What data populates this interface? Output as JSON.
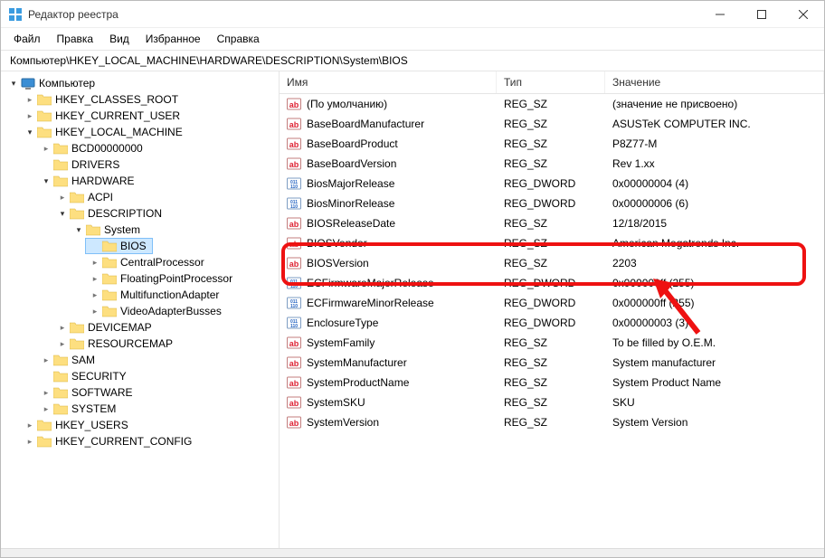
{
  "window": {
    "title": "Редактор реестра"
  },
  "menu": [
    "Файл",
    "Правка",
    "Вид",
    "Избранное",
    "Справка"
  ],
  "address": "Компьютер\\HKEY_LOCAL_MACHINE\\HARDWARE\\DESCRIPTION\\System\\BIOS",
  "tree": {
    "root": "Компьютер",
    "items": [
      {
        "label": "HKEY_CLASSES_ROOT",
        "caret": "closed",
        "depth": 1
      },
      {
        "label": "HKEY_CURRENT_USER",
        "caret": "closed",
        "depth": 1
      },
      {
        "label": "HKEY_LOCAL_MACHINE",
        "caret": "open",
        "depth": 1
      },
      {
        "label": "BCD00000000",
        "caret": "closed",
        "depth": 2
      },
      {
        "label": "DRIVERS",
        "caret": "none",
        "depth": 2
      },
      {
        "label": "HARDWARE",
        "caret": "open",
        "depth": 2
      },
      {
        "label": "ACPI",
        "caret": "closed",
        "depth": 3
      },
      {
        "label": "DESCRIPTION",
        "caret": "open",
        "depth": 3
      },
      {
        "label": "System",
        "caret": "open",
        "depth": 4
      },
      {
        "label": "BIOS",
        "caret": "none",
        "depth": 5,
        "selected": true
      },
      {
        "label": "CentralProcessor",
        "caret": "closed",
        "depth": 5
      },
      {
        "label": "FloatingPointProcessor",
        "caret": "closed",
        "depth": 5
      },
      {
        "label": "MultifunctionAdapter",
        "caret": "closed",
        "depth": 5
      },
      {
        "label": "VideoAdapterBusses",
        "caret": "closed",
        "depth": 5
      },
      {
        "label": "DEVICEMAP",
        "caret": "closed",
        "depth": 3
      },
      {
        "label": "RESOURCEMAP",
        "caret": "closed",
        "depth": 3
      },
      {
        "label": "SAM",
        "caret": "closed",
        "depth": 2
      },
      {
        "label": "SECURITY",
        "caret": "none",
        "depth": 2
      },
      {
        "label": "SOFTWARE",
        "caret": "closed",
        "depth": 2
      },
      {
        "label": "SYSTEM",
        "caret": "closed",
        "depth": 2
      },
      {
        "label": "HKEY_USERS",
        "caret": "closed",
        "depth": 1
      },
      {
        "label": "HKEY_CURRENT_CONFIG",
        "caret": "closed",
        "depth": 1
      }
    ]
  },
  "list": {
    "headers": {
      "name": "Имя",
      "type": "Тип",
      "value": "Значение"
    },
    "rows": [
      {
        "icon": "sz",
        "name": "(По умолчанию)",
        "type": "REG_SZ",
        "value": "(значение не присвоено)"
      },
      {
        "icon": "sz",
        "name": "BaseBoardManufacturer",
        "type": "REG_SZ",
        "value": "ASUSTeK COMPUTER INC."
      },
      {
        "icon": "sz",
        "name": "BaseBoardProduct",
        "type": "REG_SZ",
        "value": "P8Z77-M"
      },
      {
        "icon": "sz",
        "name": "BaseBoardVersion",
        "type": "REG_SZ",
        "value": "Rev 1.xx"
      },
      {
        "icon": "dw",
        "name": "BiosMajorRelease",
        "type": "REG_DWORD",
        "value": "0x00000004 (4)"
      },
      {
        "icon": "dw",
        "name": "BiosMinorRelease",
        "type": "REG_DWORD",
        "value": "0x00000006 (6)"
      },
      {
        "icon": "sz",
        "name": "BIOSReleaseDate",
        "type": "REG_SZ",
        "value": "12/18/2015"
      },
      {
        "icon": "sz",
        "name": "BIOSVendor",
        "type": "REG_SZ",
        "value": "American Megatrends Inc."
      },
      {
        "icon": "sz",
        "name": "BIOSVersion",
        "type": "REG_SZ",
        "value": "2203"
      },
      {
        "icon": "dw",
        "name": "ECFirmwareMajorRelease",
        "type": "REG_DWORD",
        "value": "0x000000ff (255)"
      },
      {
        "icon": "dw",
        "name": "ECFirmwareMinorRelease",
        "type": "REG_DWORD",
        "value": "0x000000ff (255)"
      },
      {
        "icon": "dw",
        "name": "EnclosureType",
        "type": "REG_DWORD",
        "value": "0x00000003 (3)"
      },
      {
        "icon": "sz",
        "name": "SystemFamily",
        "type": "REG_SZ",
        "value": "To be filled by O.E.M."
      },
      {
        "icon": "sz",
        "name": "SystemManufacturer",
        "type": "REG_SZ",
        "value": "System manufacturer"
      },
      {
        "icon": "sz",
        "name": "SystemProductName",
        "type": "REG_SZ",
        "value": "System Product Name"
      },
      {
        "icon": "sz",
        "name": "SystemSKU",
        "type": "REG_SZ",
        "value": "SKU"
      },
      {
        "icon": "sz",
        "name": "SystemVersion",
        "type": "REG_SZ",
        "value": "System Version"
      }
    ]
  }
}
